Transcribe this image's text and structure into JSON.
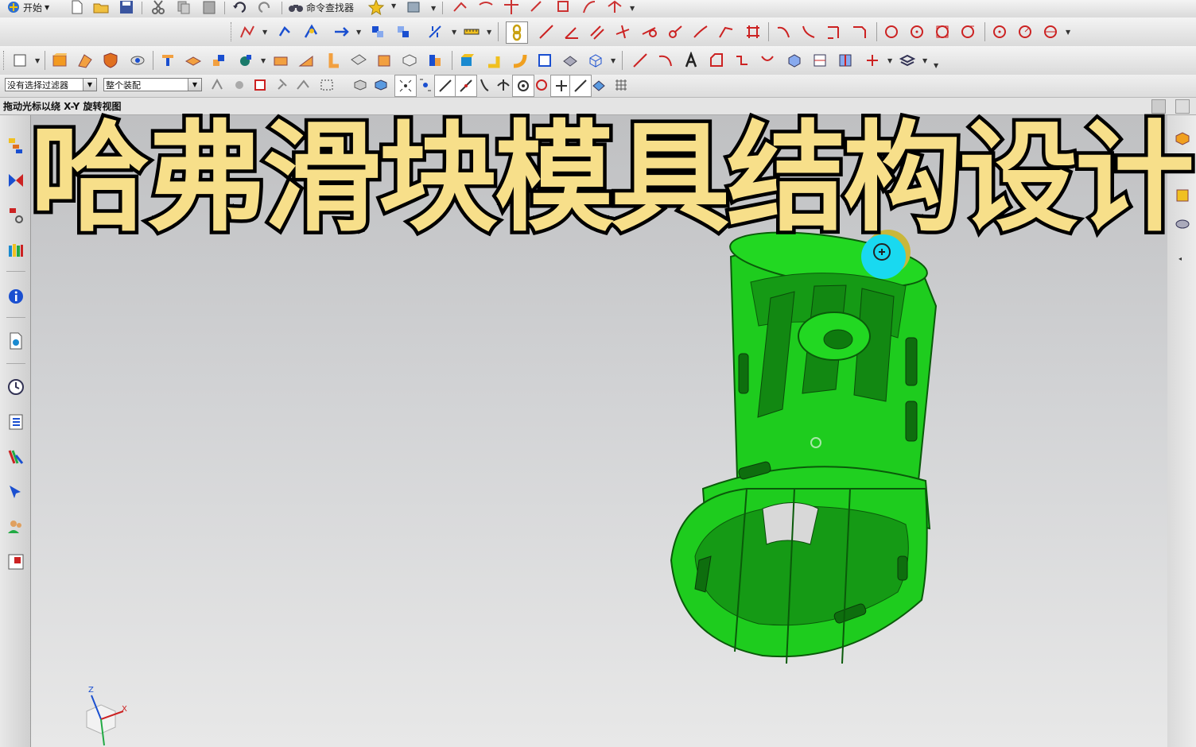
{
  "toolbar_row1": {
    "start_label": "开始",
    "command_finder_label": "命令查找器"
  },
  "selection_bar": {
    "filter_value": "没有选择过滤器",
    "scope_value": "整个装配"
  },
  "status": {
    "prompt": "拖动光标以绕 X-Y 旋转视图"
  },
  "overlay": {
    "title": "哈弗滑块模具结构设计"
  },
  "triad": {
    "z_label": "Z",
    "x_label": "X"
  },
  "colors": {
    "model_green": "#1ed21e",
    "title_fill": "#f7df8a",
    "rotate_cursor_cyan": "#19d9f0",
    "rotate_cursor_yellow": "#c9b73a"
  }
}
